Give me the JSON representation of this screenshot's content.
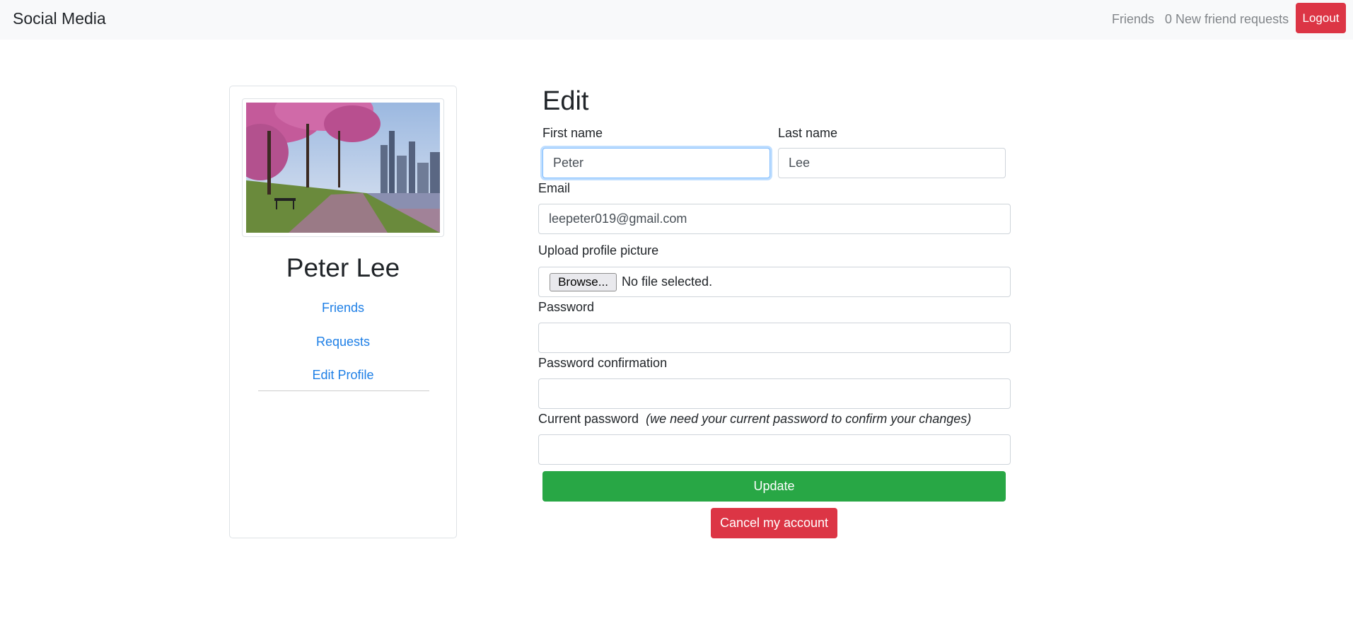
{
  "navbar": {
    "brand": "Social Media",
    "friends_link": "Friends",
    "requests_link": "0 New friend requests",
    "logout_label": "Logout"
  },
  "profile": {
    "name": "Peter Lee",
    "photo": "cherry-blossom-walkway-photo",
    "links": [
      "Friends",
      "Requests",
      "Edit Profile"
    ]
  },
  "form": {
    "title": "Edit",
    "first_name_label": "First name",
    "first_name_value": "Peter",
    "last_name_label": "Last name",
    "last_name_value": "Lee",
    "email_label": "Email",
    "email_value": "leepeter019@gmail.com",
    "upload_label": "Upload profile picture",
    "browse_label": "Browse...",
    "no_file_text": "No file selected.",
    "password_label": "Password",
    "password_confirmation_label": "Password confirmation",
    "current_password_label": "Current password",
    "current_password_hint": "(we need your current password to confirm your changes)",
    "update_label": "Update",
    "cancel_label": "Cancel my account"
  },
  "colors": {
    "primary_link": "#1e7fe6",
    "success": "#28a745",
    "danger": "#dc3545",
    "navbar_bg": "#f8f9fa"
  }
}
